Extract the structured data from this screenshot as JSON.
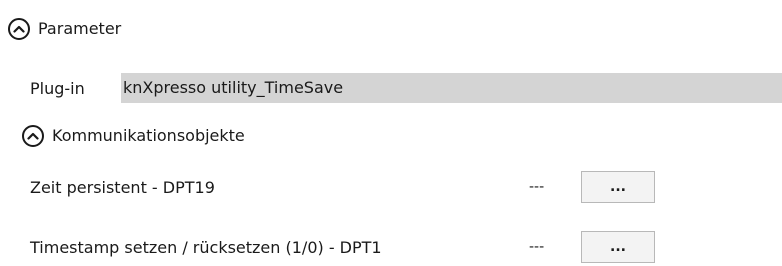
{
  "parameter_section": {
    "title": "Parameter",
    "expanded": true,
    "icon": "chevron-up-circle-icon"
  },
  "plugin": {
    "label": "Plug-in",
    "value": "knXpresso utility_TimeSave"
  },
  "komm_section": {
    "title": "Kommunikationsobjekte",
    "expanded": true,
    "icon": "chevron-up-circle-icon"
  },
  "objects": [
    {
      "name": "Zeit persistent - DPT19",
      "address": "---",
      "button_label": "..."
    },
    {
      "name": "Timestamp setzen / rücksetzen (1/0) - DPT1",
      "address": "---",
      "button_label": "..."
    }
  ],
  "colors": {
    "plugin_value_background": "#d4d4d4",
    "button_background": "#f3f3f3",
    "button_border": "#b8b8b8"
  }
}
